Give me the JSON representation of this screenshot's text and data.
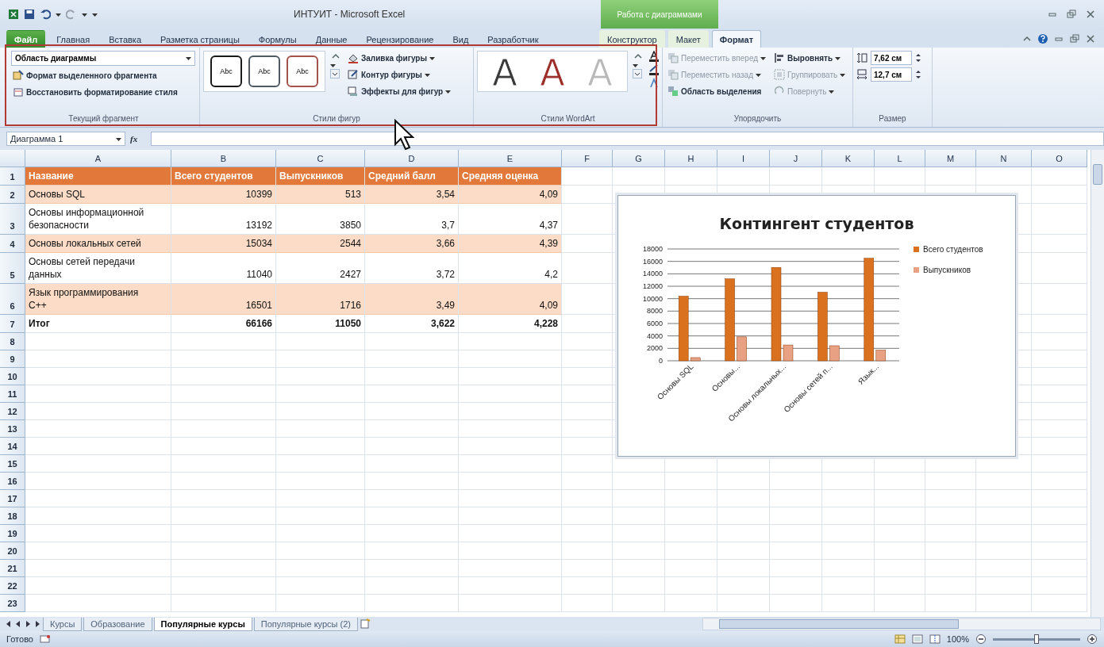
{
  "window": {
    "title": "ИНТУИТ - Microsoft Excel",
    "context_title": "Работа с диаграммами"
  },
  "tabs": [
    {
      "label": "Файл",
      "kind": "file",
      "selected": false
    },
    {
      "label": "Главная",
      "kind": "normal",
      "selected": false
    },
    {
      "label": "Вставка",
      "kind": "normal",
      "selected": false
    },
    {
      "label": "Разметка страницы",
      "kind": "normal",
      "selected": false
    },
    {
      "label": "Формулы",
      "kind": "normal",
      "selected": false
    },
    {
      "label": "Данные",
      "kind": "normal",
      "selected": false
    },
    {
      "label": "Рецензирование",
      "kind": "normal",
      "selected": false
    },
    {
      "label": "Вид",
      "kind": "normal",
      "selected": false
    },
    {
      "label": "Разработчик",
      "kind": "normal",
      "selected": false
    },
    {
      "label": "Конструктор",
      "kind": "context",
      "selected": false
    },
    {
      "label": "Макет",
      "kind": "context",
      "selected": false
    },
    {
      "label": "Формат",
      "kind": "context",
      "selected": true
    }
  ],
  "ribbon": {
    "groups": [
      {
        "title": "Текущий фрагмент",
        "kind": "selection",
        "dropdown": "Область диаграммы",
        "commands": [
          {
            "label": "Формат выделенного фрагмента",
            "menu": false,
            "disabled": false
          },
          {
            "label": "Восстановить форматирование стиля",
            "menu": false,
            "disabled": false
          }
        ]
      },
      {
        "title": "Стили фигур",
        "kind": "shape_styles",
        "samples": [
          {
            "label": "Abc",
            "color": "#1a1a1a"
          },
          {
            "label": "Abc",
            "color": "#4f5a63"
          },
          {
            "label": "Abc",
            "color": "#a4534c"
          }
        ],
        "commands": [
          {
            "label": "Заливка фигуры",
            "menu": true,
            "disabled": false
          },
          {
            "label": "Контур фигуры",
            "menu": true,
            "disabled": false
          },
          {
            "label": "Эффекты для фигур",
            "menu": true,
            "disabled": false
          }
        ]
      },
      {
        "title": "Стили WordArt",
        "kind": "wordart",
        "samples": [
          {
            "label": "A",
            "color": "#3a3a3a"
          },
          {
            "label": "A",
            "color": "#9c2f2a"
          },
          {
            "label": "A",
            "color": "#b8b8b8"
          }
        ]
      },
      {
        "title": "Упорядочить",
        "kind": "arrange",
        "commands": [
          {
            "label": "Переместить вперед",
            "menu": true,
            "disabled": true
          },
          {
            "label": "Переместить назад",
            "menu": true,
            "disabled": true
          },
          {
            "label": "Область выделения",
            "menu": false,
            "disabled": false
          },
          {
            "label": "Выровнять",
            "menu": true,
            "disabled": false
          },
          {
            "label": "Группировать",
            "menu": true,
            "disabled": true
          },
          {
            "label": "Повернуть",
            "menu": true,
            "disabled": true
          }
        ]
      },
      {
        "title": "Размер",
        "kind": "size",
        "fields": [
          {
            "value": "7,62 см"
          },
          {
            "value": "12,7 см"
          }
        ]
      }
    ]
  },
  "formula_bar": {
    "name_box": "Диаграмма 1",
    "function_label": "fx"
  },
  "sheet": {
    "columns": [
      "A",
      "B",
      "C",
      "D",
      "E",
      "F",
      "G",
      "H",
      "I",
      "J",
      "K",
      "L",
      "M",
      "N",
      "O"
    ],
    "rows": [
      {
        "number": "1",
        "kind": "header",
        "cells": [
          "Название",
          "Всего студентов",
          "Выпускников",
          "Средний балл",
          "Средняя оценка"
        ]
      },
      {
        "number": "2",
        "kind": "band",
        "cells": [
          "Основы SQL",
          "10399",
          "513",
          "3,54",
          "4,09"
        ]
      },
      {
        "number": "3",
        "kind": "plain",
        "cells": [
          "Основы информационной безопасности",
          "13192",
          "3850",
          "3,7",
          "4,37"
        ]
      },
      {
        "number": "4",
        "kind": "band",
        "cells": [
          "Основы локальных сетей",
          "15034",
          "2544",
          "3,66",
          "4,39"
        ]
      },
      {
        "number": "5",
        "kind": "plain",
        "cells": [
          "Основы сетей передачи данных",
          "11040",
          "2427",
          "3,72",
          "4,2"
        ]
      },
      {
        "number": "6",
        "kind": "band",
        "cells": [
          "Язык программирования C++",
          "16501",
          "1716",
          "3,49",
          "4,09"
        ]
      },
      {
        "number": "7",
        "kind": "total",
        "cells": [
          "Итог",
          "66166",
          "11050",
          "3,622",
          "4,228"
        ]
      },
      {
        "number": "8",
        "kind": "empty"
      },
      {
        "number": "9",
        "kind": "empty"
      },
      {
        "number": "10",
        "kind": "empty"
      },
      {
        "number": "11",
        "kind": "empty"
      },
      {
        "number": "12",
        "kind": "empty"
      },
      {
        "number": "13",
        "kind": "empty"
      },
      {
        "number": "14",
        "kind": "empty"
      },
      {
        "number": "15",
        "kind": "empty"
      },
      {
        "number": "16",
        "kind": "empty"
      },
      {
        "number": "17",
        "kind": "empty"
      },
      {
        "number": "18",
        "kind": "empty"
      },
      {
        "number": "19",
        "kind": "empty"
      },
      {
        "number": "20",
        "kind": "empty"
      },
      {
        "number": "21",
        "kind": "empty"
      },
      {
        "number": "22",
        "kind": "empty"
      },
      {
        "number": "23",
        "kind": "empty"
      }
    ]
  },
  "chart": {
    "chart_data": {
      "type": "bar",
      "title": "Контингент студентов",
      "categories": [
        "Основы SQL",
        "Основы...",
        "Основы локальных...",
        "Основы сетей п...",
        "Язык..."
      ],
      "series": [
        {
          "name": "Всего студентов",
          "color": "#d9711e",
          "values": [
            10399,
            13192,
            15034,
            11040,
            16501
          ]
        },
        {
          "name": "Выпускников",
          "color": "#e9a183",
          "values": [
            513,
            3850,
            2544,
            2427,
            1716
          ]
        }
      ],
      "ylim": [
        0,
        18000
      ],
      "yticks": [
        0,
        2000,
        4000,
        6000,
        8000,
        10000,
        12000,
        14000,
        16000,
        18000
      ],
      "grid": true,
      "legend": "right"
    }
  },
  "sheet_tabs": [
    {
      "label": "Курсы",
      "selected": false
    },
    {
      "label": "Образование",
      "selected": false
    },
    {
      "label": "Популярные курсы",
      "selected": true
    },
    {
      "label": "Популярные курсы (2)",
      "selected": false
    }
  ],
  "status_bar": {
    "state": "Готово",
    "zoom": "100%",
    "zoom_slider": {
      "level": 0.5
    }
  }
}
